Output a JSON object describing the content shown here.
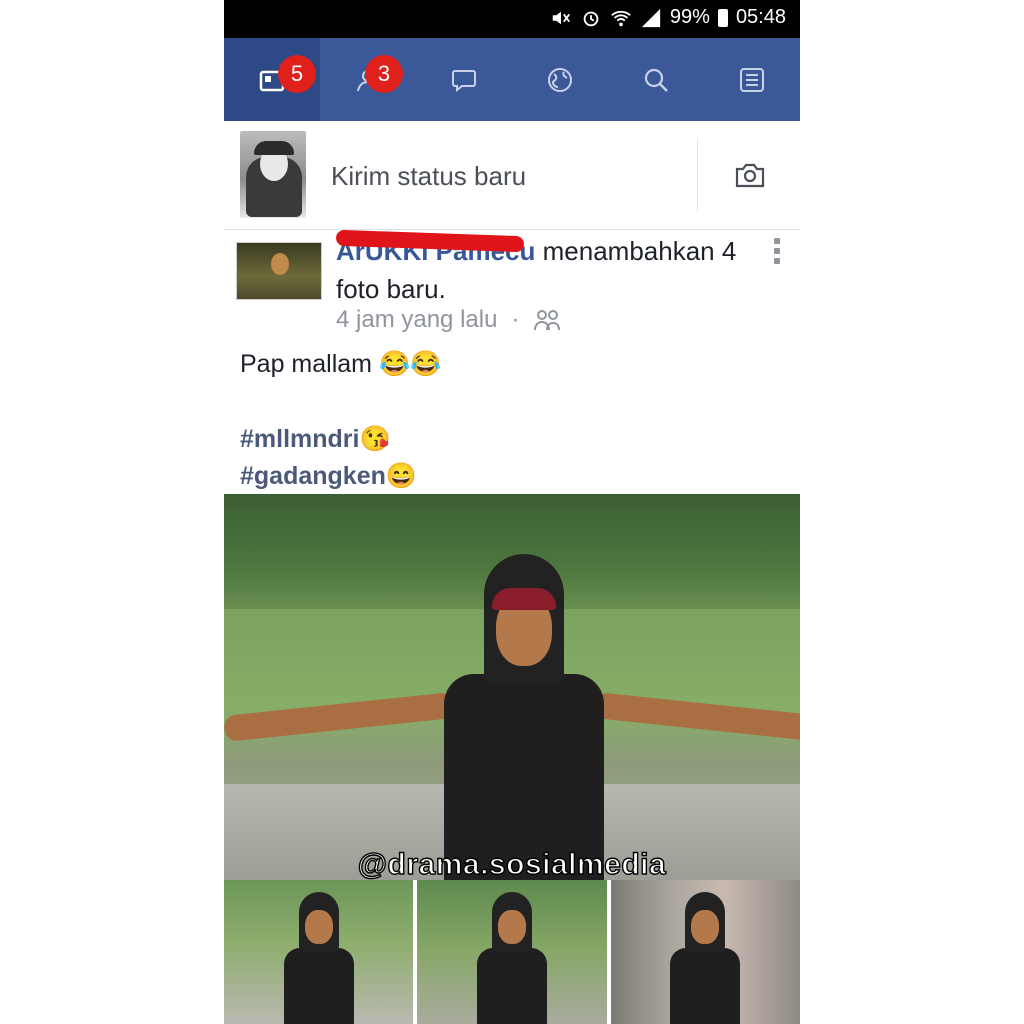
{
  "status_bar": {
    "battery": "99%",
    "time": "05:48"
  },
  "nav": {
    "items": [
      {
        "name": "news-feed",
        "badge": "5",
        "active": true
      },
      {
        "name": "friend-requests",
        "badge": "3",
        "active": false
      },
      {
        "name": "messages",
        "badge": "",
        "active": false
      },
      {
        "name": "notifications",
        "badge": "",
        "active": false
      },
      {
        "name": "search",
        "badge": "",
        "active": false
      },
      {
        "name": "more-menu",
        "badge": "",
        "active": false
      }
    ],
    "accent": "#3b5998",
    "badge_color": "#e0201b"
  },
  "composer": {
    "placeholder": "Kirim status baru"
  },
  "post": {
    "author": "ArUKKi Pamecu",
    "action": " menambahkan 4 foto baru.",
    "time": "4 jam yang lalu",
    "privacy_icon": "friends-icon",
    "text": "Pap mallam 😂😂",
    "hashtags": [
      "#mllmndri😘",
      "#gadangken😄"
    ]
  },
  "watermark": "@drama.sosialmedia"
}
